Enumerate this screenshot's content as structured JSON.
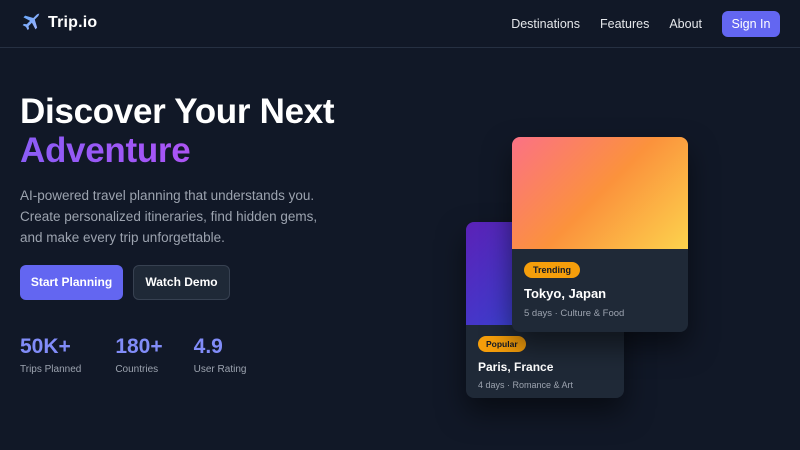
{
  "brand": {
    "name": "Trip.io",
    "icon": "airplane-icon",
    "accent": "#6366f1"
  },
  "nav": {
    "links": [
      "Destinations",
      "Features",
      "About"
    ],
    "signin_label": "Sign In"
  },
  "hero": {
    "title_line1": "Discover Your Next",
    "title_line2": "Adventure",
    "description": [
      "AI-powered travel planning that understands you.",
      "Create personalized itineraries, find hidden gems,",
      "and make every trip unforgettable."
    ],
    "primary_cta": "Start Planning",
    "secondary_cta": "Watch Demo"
  },
  "stats": [
    {
      "value": "50K+",
      "label": "Trips Planned"
    },
    {
      "value": "180+",
      "label": "Countries"
    },
    {
      "value": "4.9",
      "label": "User Rating"
    }
  ],
  "cards": {
    "front": {
      "badge": "Trending",
      "title": "Tokyo, Japan",
      "meta": "5 days · Culture & Food"
    },
    "back": {
      "badge": "Popular",
      "title": "Paris, France",
      "meta": "4 days · Romance & Art"
    }
  },
  "colors": {
    "background": "#111827",
    "accent": "#6366f1",
    "stat": "#818cf8",
    "badge": "#f59e0b"
  }
}
